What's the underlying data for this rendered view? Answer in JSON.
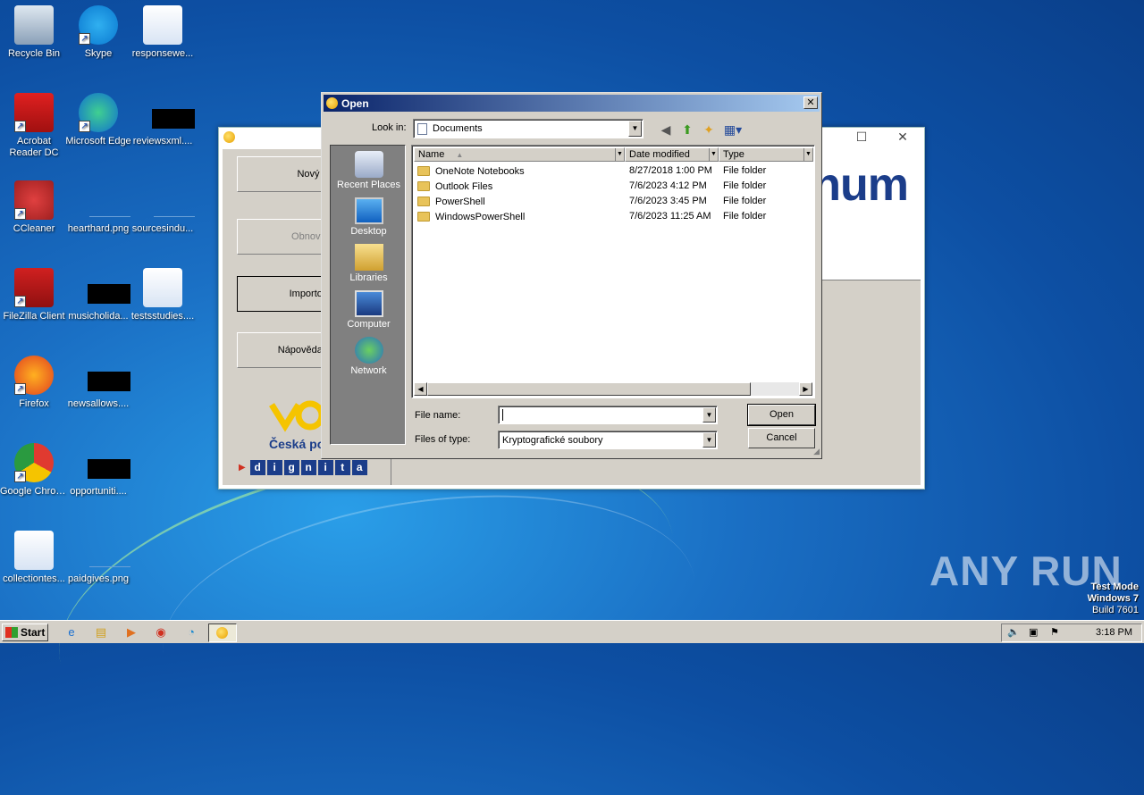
{
  "desktop": {
    "icons": [
      {
        "label": "Recycle Bin",
        "icon": "recycle-bin-icon"
      },
      {
        "label": "Skype",
        "icon": "skype-icon"
      },
      {
        "label": "responsewe...",
        "icon": "word-doc-icon"
      },
      {
        "label": "Acrobat Reader DC",
        "icon": "acrobat-icon"
      },
      {
        "label": "Microsoft Edge",
        "icon": "edge-icon"
      },
      {
        "label": "reviewsxml....",
        "icon": "file-icon"
      },
      {
        "label": "CCleaner",
        "icon": "ccleaner-icon"
      },
      {
        "label": "hearthard.png",
        "icon": "image-icon"
      },
      {
        "label": "sourcesindu...",
        "icon": "image-icon"
      },
      {
        "label": "FileZilla Client",
        "icon": "filezilla-icon"
      },
      {
        "label": "musicholida...",
        "icon": "file-icon"
      },
      {
        "label": "testsstudies....",
        "icon": "word-doc-icon"
      },
      {
        "label": "Firefox",
        "icon": "firefox-icon"
      },
      {
        "label": "newsallows....",
        "icon": "file-icon"
      },
      {
        "label": "Google Chrome",
        "icon": "chrome-icon"
      },
      {
        "label": "opportuniti....",
        "icon": "file-icon"
      },
      {
        "label": "collectiontes...",
        "icon": "word-doc-icon"
      },
      {
        "label": "paidgives.png",
        "icon": "image-icon"
      }
    ]
  },
  "app": {
    "buttons": [
      "Nový",
      "Obnovit",
      "Importov",
      "Nápověda a o"
    ],
    "brand": "num",
    "post_name": "Česká po",
    "dignita_letters": [
      "d",
      "i",
      "g",
      "n",
      "i",
      "t",
      "a"
    ]
  },
  "dialog": {
    "title": "Open",
    "close_label": "✕",
    "look_in_label": "Look in:",
    "look_in_value": "Documents",
    "places": [
      "Recent Places",
      "Desktop",
      "Libraries",
      "Computer",
      "Network"
    ],
    "columns": [
      "Name",
      "Date modified",
      "Type"
    ],
    "files": [
      {
        "name": "OneNote Notebooks",
        "date": "8/27/2018 1:00 PM",
        "type": "File folder"
      },
      {
        "name": "Outlook Files",
        "date": "7/6/2023 4:12 PM",
        "type": "File folder"
      },
      {
        "name": "PowerShell",
        "date": "7/6/2023 3:45 PM",
        "type": "File folder"
      },
      {
        "name": "WindowsPowerShell",
        "date": "7/6/2023 11:25 AM",
        "type": "File folder"
      }
    ],
    "file_name_label": "File name:",
    "file_name_value": "",
    "files_of_type_label": "Files of type:",
    "files_of_type_value": "Kryptografické soubory",
    "open_label": "Open",
    "cancel_label": "Cancel"
  },
  "taskbar": {
    "start_label": "Start",
    "clock": "3:18 PM"
  },
  "watermark": {
    "line1": "Test Mode",
    "line2": "Windows 7",
    "line3": "Build 7601",
    "brand": "ANY RUN"
  }
}
